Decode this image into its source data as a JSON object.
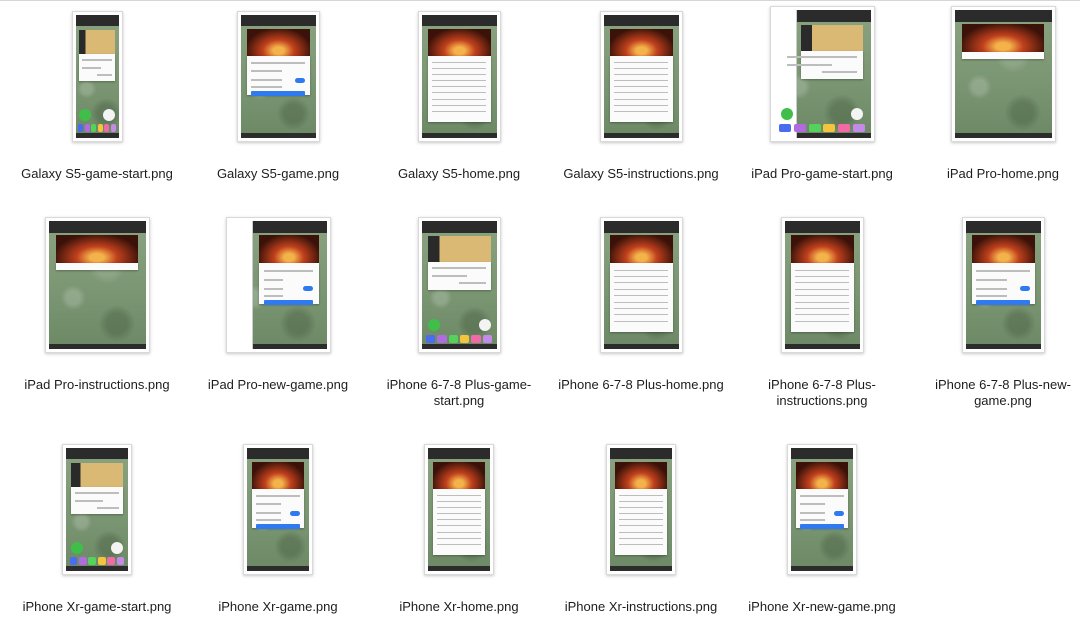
{
  "files": [
    {
      "name": "Galaxy S5-game-start.png",
      "variant": "phone-start"
    },
    {
      "name": "Galaxy S5-game.png",
      "variant": "phone-game"
    },
    {
      "name": "Galaxy S5-home.png",
      "variant": "phone-home"
    },
    {
      "name": "Galaxy S5-instructions.png",
      "variant": "phone-home"
    },
    {
      "name": "iPad Pro-game-start.png",
      "variant": "tablet-start"
    },
    {
      "name": "iPad Pro-home.png",
      "variant": "tablet-home"
    },
    {
      "name": "iPad Pro-instructions.png",
      "variant": "tablet-home"
    },
    {
      "name": "iPad Pro-new-game.png",
      "variant": "tablet-new"
    },
    {
      "name": "iPhone 6-7-8 Plus-game-start.png",
      "variant": "phone-start"
    },
    {
      "name": "iPhone 6-7-8 Plus-home.png",
      "variant": "phone-home"
    },
    {
      "name": "iPhone 6-7-8 Plus-instructions.png",
      "variant": "phone-home"
    },
    {
      "name": "iPhone 6-7-8 Plus-new-game.png",
      "variant": "phone-game"
    },
    {
      "name": "iPhone Xr-game-start.png",
      "variant": "phone-start"
    },
    {
      "name": "iPhone Xr-game.png",
      "variant": "phone-game"
    },
    {
      "name": "iPhone Xr-home.png",
      "variant": "phone-home"
    },
    {
      "name": "iPhone Xr-instructions.png",
      "variant": "phone-home"
    },
    {
      "name": "iPhone Xr-new-game.png",
      "variant": "phone-game"
    }
  ],
  "colors": {
    "dock": [
      "#4a6cf0",
      "#b06be0",
      "#55d15c",
      "#f2c53d",
      "#ef6aa6",
      "#c48ae8"
    ],
    "fab_green": "#3fbf4a",
    "accent": "#2f7af0"
  }
}
